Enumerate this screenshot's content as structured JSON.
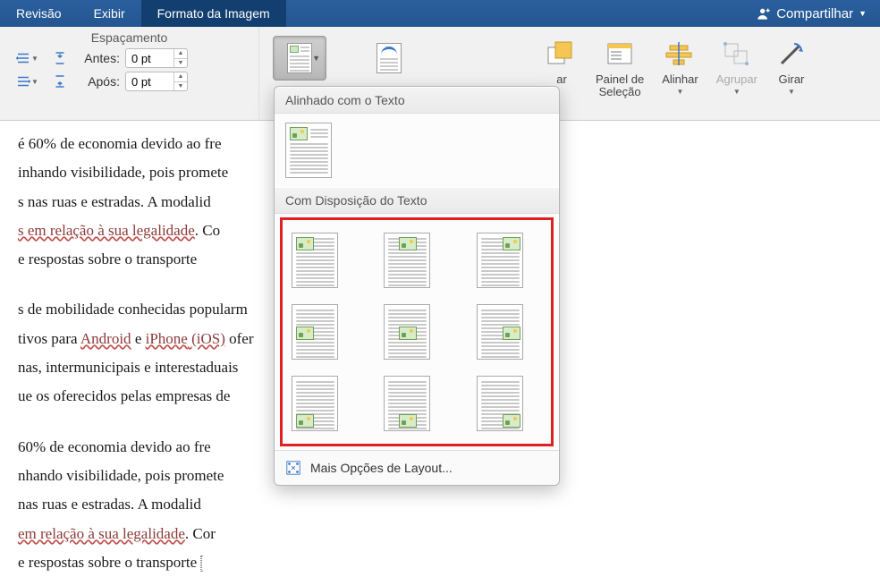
{
  "tabs": {
    "revisao": "Revisão",
    "exibir": "Exibir",
    "formato_imagem": "Formato da Imagem"
  },
  "share": {
    "label": "Compartilhar"
  },
  "spacing": {
    "group_title": "Espaçamento",
    "before_label": "Antes:",
    "after_label": "Após:",
    "before_value": "0 pt",
    "after_value": "0 pt"
  },
  "ribbon_right": {
    "ar_partial": "ar",
    "painel": "Painel de\nSeleção",
    "alinhar": "Alinhar",
    "agrupar": "Agrupar",
    "girar": "Girar"
  },
  "popover": {
    "section1": "Alinhado com o Texto",
    "section2": "Com Disposição do Texto",
    "more": "Mais Opções de Layout..."
  },
  "doc": {
    "p1_a": "é 60% de economia devido ao fre",
    "p1_b": "inhando visibilidade, pois promete",
    "p1_c": "s nas ruas e estradas. A modalid",
    "p1_d": "s em relação à sua legalidade",
    "p1_d2": ". Co",
    "p1_e": "e respostas sobre o transporte ",
    "p2_a": "s de mobilidade conhecidas popularm",
    "p2_b": "tivos para ",
    "p2_b_android": "Android",
    "p2_b_mid": " e ",
    "p2_b_iphone": "iPhone",
    "p2_b_ios": " (iOS)",
    "p2_b_end": " ofer",
    "p2_c": "nas, intermunicipais e interestaduais ",
    "p2_d": "ue os oferecidos pelas empresas de ",
    "p3_a": "60% de economia devido ao fre",
    "p3_b": "nhando visibilidade, pois promete",
    "p3_c": " nas ruas e estradas. A modalid",
    "p3_d": "em relação à sua legalidade",
    "p3_d2": ". Cor",
    "p3_e": " e respostas sobre o transporte "
  }
}
